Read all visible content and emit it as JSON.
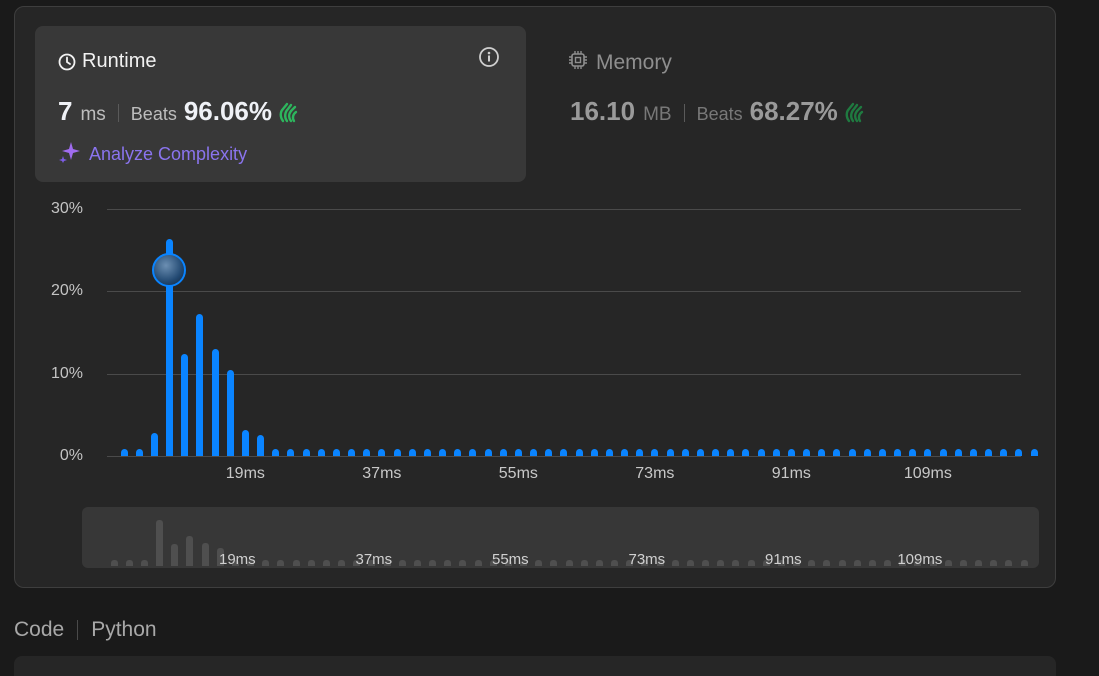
{
  "runtime": {
    "title": "Runtime",
    "value": "7",
    "unit": "ms",
    "beats_label": "Beats",
    "beats_pct": "96.06%",
    "analyze_label": "Analyze Complexity"
  },
  "memory": {
    "title": "Memory",
    "value": "16.10",
    "unit": "MB",
    "beats_label": "Beats",
    "beats_pct": "68.27%"
  },
  "colors": {
    "accent": "#0a84ff",
    "clap": "#2db55d",
    "analyze": "#8a74ee"
  },
  "chart_data": {
    "type": "bar",
    "ylim": [
      0,
      30
    ],
    "yticks": [
      "30%",
      "20%",
      "10%",
      "0%"
    ],
    "xtick_labels": [
      "19ms",
      "37ms",
      "55ms",
      "73ms",
      "91ms",
      "109ms"
    ],
    "xtick_values": [
      19,
      37,
      55,
      73,
      91,
      109
    ],
    "x": [
      3,
      5,
      7,
      9,
      11,
      13,
      15,
      17,
      19,
      21,
      23,
      25,
      27,
      29,
      31,
      33,
      35,
      37,
      39,
      41,
      43,
      45,
      47,
      49,
      51,
      53,
      55,
      57,
      59,
      61,
      63,
      65,
      67,
      69,
      71,
      73,
      75,
      77,
      79,
      81,
      83,
      85,
      87,
      89,
      91,
      93,
      95,
      97,
      99,
      101,
      103,
      105,
      107,
      109,
      111,
      113,
      115,
      117,
      119,
      121,
      123
    ],
    "values": [
      0.8,
      0.9,
      2.8,
      26.3,
      12.4,
      17.3,
      13.0,
      10.5,
      3.2,
      2.6,
      0.8,
      0.8,
      0.8,
      0.8,
      0.8,
      0.8,
      0.8,
      0.8,
      0.8,
      0.8,
      0.8,
      0.8,
      0.8,
      0.8,
      0.8,
      0.8,
      0.8,
      0.8,
      0.8,
      0.8,
      0.8,
      0.8,
      0.8,
      0.8,
      0.8,
      0.8,
      0.8,
      0.8,
      0.8,
      0.8,
      0.8,
      0.8,
      0.8,
      0.8,
      0.8,
      0.8,
      0.8,
      0.8,
      0.8,
      0.8,
      0.8,
      0.8,
      0.8,
      0.8,
      0.8,
      0.8,
      0.8,
      0.8,
      0.8,
      0.8,
      0.8
    ],
    "highlight_x": 9,
    "grid": true
  },
  "navigator": {
    "xtick_labels": [
      "19ms",
      "37ms",
      "55ms",
      "73ms",
      "91ms",
      "109ms"
    ]
  },
  "bottom": {
    "tab_code": "Code",
    "tab_language": "Python"
  }
}
